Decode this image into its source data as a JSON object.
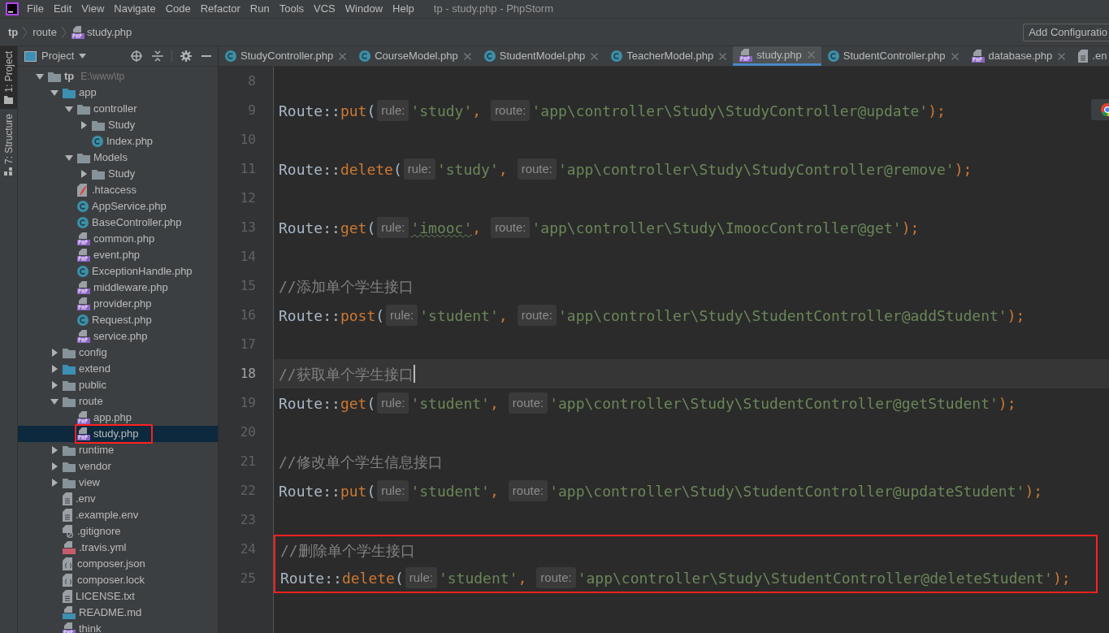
{
  "menu": [
    "File",
    "Edit",
    "View",
    "Navigate",
    "Code",
    "Refactor",
    "Run",
    "Tools",
    "VCS",
    "Window",
    "Help"
  ],
  "window": {
    "title": "tp - study.php - PhpStorm"
  },
  "breadcrumb": [
    {
      "label": "tp",
      "kind": "project"
    },
    {
      "label": "route",
      "kind": "folder"
    },
    {
      "label": "study.php",
      "kind": "php"
    }
  ],
  "run_config_button": "Add Configuratio",
  "side_tabs": [
    {
      "label": "1: Project",
      "selected": true
    },
    {
      "label": "7: Structure",
      "selected": false
    }
  ],
  "project_panel": {
    "title": "Project",
    "tree": [
      {
        "name": "tp",
        "hint": "E:\\www\\tp",
        "kind": "folder",
        "expanded": true,
        "selected": false,
        "children": [
          {
            "name": "app",
            "kind": "source-folder",
            "expanded": true,
            "selected": false,
            "children": [
              {
                "name": "controller",
                "kind": "folder",
                "expanded": true,
                "selected": false,
                "children": [
                  {
                    "name": "Study",
                    "kind": "folder",
                    "expanded": false,
                    "selected": false
                  },
                  {
                    "name": "Index.php",
                    "kind": "class",
                    "selected": false
                  }
                ]
              },
              {
                "name": "Models",
                "kind": "folder",
                "expanded": true,
                "selected": false,
                "children": [
                  {
                    "name": "Study",
                    "kind": "folder",
                    "expanded": false,
                    "selected": false
                  }
                ]
              },
              {
                "name": ".htaccess",
                "kind": "feather",
                "selected": false
              },
              {
                "name": "AppService.php",
                "kind": "class",
                "selected": false
              },
              {
                "name": "BaseController.php",
                "kind": "class",
                "selected": false
              },
              {
                "name": "common.php",
                "kind": "php",
                "selected": false
              },
              {
                "name": "event.php",
                "kind": "php",
                "selected": false
              },
              {
                "name": "ExceptionHandle.php",
                "kind": "class",
                "selected": false
              },
              {
                "name": "middleware.php",
                "kind": "php",
                "selected": false
              },
              {
                "name": "provider.php",
                "kind": "php",
                "selected": false
              },
              {
                "name": "Request.php",
                "kind": "class",
                "selected": false
              },
              {
                "name": "service.php",
                "kind": "php",
                "selected": false
              }
            ]
          },
          {
            "name": "config",
            "kind": "folder",
            "expanded": false,
            "selected": false
          },
          {
            "name": "extend",
            "kind": "source-folder",
            "expanded": false,
            "selected": false
          },
          {
            "name": "public",
            "kind": "folder",
            "expanded": false,
            "selected": false
          },
          {
            "name": "route",
            "kind": "folder",
            "expanded": true,
            "selected": false,
            "children": [
              {
                "name": "app.php",
                "kind": "php",
                "selected": false
              },
              {
                "name": "study.php",
                "kind": "php",
                "selected": true,
                "annotated": true
              }
            ]
          },
          {
            "name": "runtime",
            "kind": "folder",
            "expanded": false,
            "selected": false
          },
          {
            "name": "vendor",
            "kind": "folder",
            "expanded": false,
            "selected": false
          },
          {
            "name": "view",
            "kind": "folder",
            "expanded": false,
            "selected": false
          },
          {
            "name": ".env",
            "kind": "text",
            "selected": false
          },
          {
            "name": ".example.env",
            "kind": "text",
            "selected": false
          },
          {
            "name": ".gitignore",
            "kind": "ignore",
            "selected": false
          },
          {
            "name": ".travis.yml",
            "kind": "yml",
            "selected": false
          },
          {
            "name": "composer.json",
            "kind": "json",
            "selected": false
          },
          {
            "name": "composer.lock",
            "kind": "json",
            "selected": false
          },
          {
            "name": "LICENSE.txt",
            "kind": "text",
            "selected": false
          },
          {
            "name": "README.md",
            "kind": "md",
            "selected": false
          },
          {
            "name": "think",
            "kind": "php",
            "selected": false
          }
        ]
      }
    ]
  },
  "editor_tabs": [
    {
      "label": "StudyController.php",
      "kind": "class",
      "selected": false
    },
    {
      "label": "CourseModel.php",
      "kind": "class",
      "selected": false
    },
    {
      "label": "StudentModel.php",
      "kind": "class",
      "selected": false
    },
    {
      "label": "TeacherModel.php",
      "kind": "class",
      "selected": false
    },
    {
      "label": "study.php",
      "kind": "php",
      "selected": true
    },
    {
      "label": "StudentController.php",
      "kind": "class",
      "selected": false
    },
    {
      "label": "database.php",
      "kind": "php",
      "selected": false
    },
    {
      "label": ".en",
      "kind": "text",
      "selected": false
    }
  ],
  "code": [
    {
      "number": "8",
      "kind": "blank",
      "current": false,
      "annotated": false
    },
    {
      "number": "9",
      "kind": "route",
      "current": false,
      "annotated": false,
      "class": "Route",
      "operator": "::",
      "method": "put",
      "open": "(",
      "rule_hint": "rule:",
      "rule": "'study'",
      "comma": ",",
      "route_hint": "route:",
      "route": "'app\\controller\\Study\\StudyController@update'",
      "close": ");"
    },
    {
      "number": "10",
      "kind": "blank",
      "current": false,
      "annotated": false
    },
    {
      "number": "11",
      "kind": "route",
      "current": false,
      "annotated": false,
      "class": "Route",
      "operator": "::",
      "method": "delete",
      "open": "(",
      "rule_hint": "rule:",
      "rule": "'study'",
      "comma": ",",
      "route_hint": "route:",
      "route": "'app\\controller\\Study\\StudyController@remove'",
      "close": ");"
    },
    {
      "number": "12",
      "kind": "blank",
      "current": false,
      "annotated": false
    },
    {
      "number": "13",
      "kind": "route",
      "current": false,
      "annotated": false,
      "class": "Route",
      "operator": "::",
      "method": "get",
      "open": "(",
      "rule_hint": "rule:",
      "rule": "'imooc'",
      "rule_warning": true,
      "comma": ",",
      "route_hint": "route:",
      "route": "'app\\controller\\Study\\ImoocController@get'",
      "close": ");"
    },
    {
      "number": "14",
      "kind": "blank",
      "current": false,
      "annotated": false
    },
    {
      "number": "15",
      "kind": "comment",
      "current": false,
      "annotated": false,
      "text": "//添加单个学生接口"
    },
    {
      "number": "16",
      "kind": "route",
      "current": false,
      "annotated": false,
      "class": "Route",
      "operator": "::",
      "method": "post",
      "open": "(",
      "rule_hint": "rule:",
      "rule": "'student'",
      "comma": ",",
      "route_hint": "route:",
      "route": "'app\\controller\\Study\\StudentController@addStudent'",
      "close": ");"
    },
    {
      "number": "17",
      "kind": "blank",
      "current": false,
      "annotated": false
    },
    {
      "number": "18",
      "kind": "comment",
      "current": true,
      "annotated": false,
      "text": "//获取单个学生接口"
    },
    {
      "number": "19",
      "kind": "route",
      "current": false,
      "annotated": false,
      "class": "Route",
      "operator": "::",
      "method": "get",
      "open": "(",
      "rule_hint": "rule:",
      "rule": "'student'",
      "comma": ",",
      "route_hint": "route:",
      "route": "'app\\controller\\Study\\StudentController@getStudent'",
      "close": ");"
    },
    {
      "number": "20",
      "kind": "blank",
      "current": false,
      "annotated": false
    },
    {
      "number": "21",
      "kind": "comment",
      "current": false,
      "annotated": false,
      "text": "//修改单个学生信息接口"
    },
    {
      "number": "22",
      "kind": "route",
      "current": false,
      "annotated": false,
      "class": "Route",
      "operator": "::",
      "method": "put",
      "open": "(",
      "rule_hint": "rule:",
      "rule": "'student'",
      "comma": ",",
      "route_hint": "route:",
      "route": "'app\\controller\\Study\\StudentController@updateStudent'",
      "close": ");"
    },
    {
      "number": "23",
      "kind": "blank",
      "current": false,
      "annotated": false
    },
    {
      "number": "24",
      "kind": "comment",
      "current": false,
      "annotated": true,
      "text": "//删除单个学生接口"
    },
    {
      "number": "25",
      "kind": "route",
      "current": false,
      "annotated": true,
      "class": "Route",
      "operator": "::",
      "method": "delete",
      "open": "(",
      "rule_hint": "rule:",
      "rule": "'student'",
      "comma": ",",
      "route_hint": "route:",
      "route": "'app\\controller\\Study\\StudentController@deleteStudent'",
      "close": ");"
    }
  ]
}
